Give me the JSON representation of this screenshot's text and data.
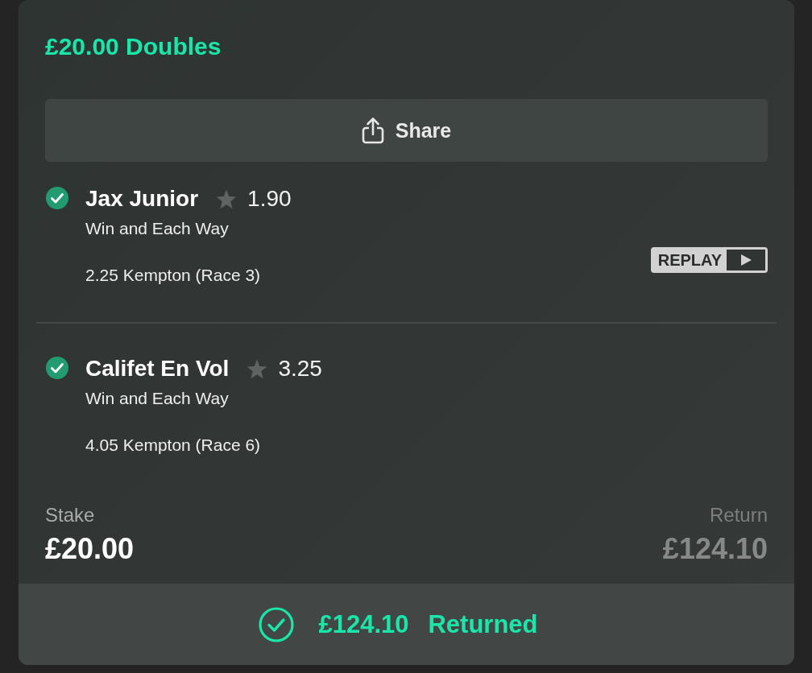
{
  "bet": {
    "title": "£20.00 Doubles"
  },
  "share_button": {
    "label": "Share"
  },
  "selections": [
    {
      "name": "Jax Junior",
      "won": true,
      "favourite": false,
      "odds": "1.90",
      "market": "Win and Each Way",
      "event": "2.25 Kempton (Race 3)",
      "replay_button": "REPLAY"
    },
    {
      "name": "Califet En Vol",
      "won": true,
      "favourite": false,
      "odds": "3.25",
      "market": "Win and Each Way",
      "event": "4.05 Kempton (Race 6)"
    }
  ],
  "summary": {
    "stake_label": "Stake",
    "stake": "£20.00",
    "return_label": "Return",
    "return": "£124.10"
  },
  "result": {
    "amount": "£124.10",
    "label": "Returned"
  }
}
